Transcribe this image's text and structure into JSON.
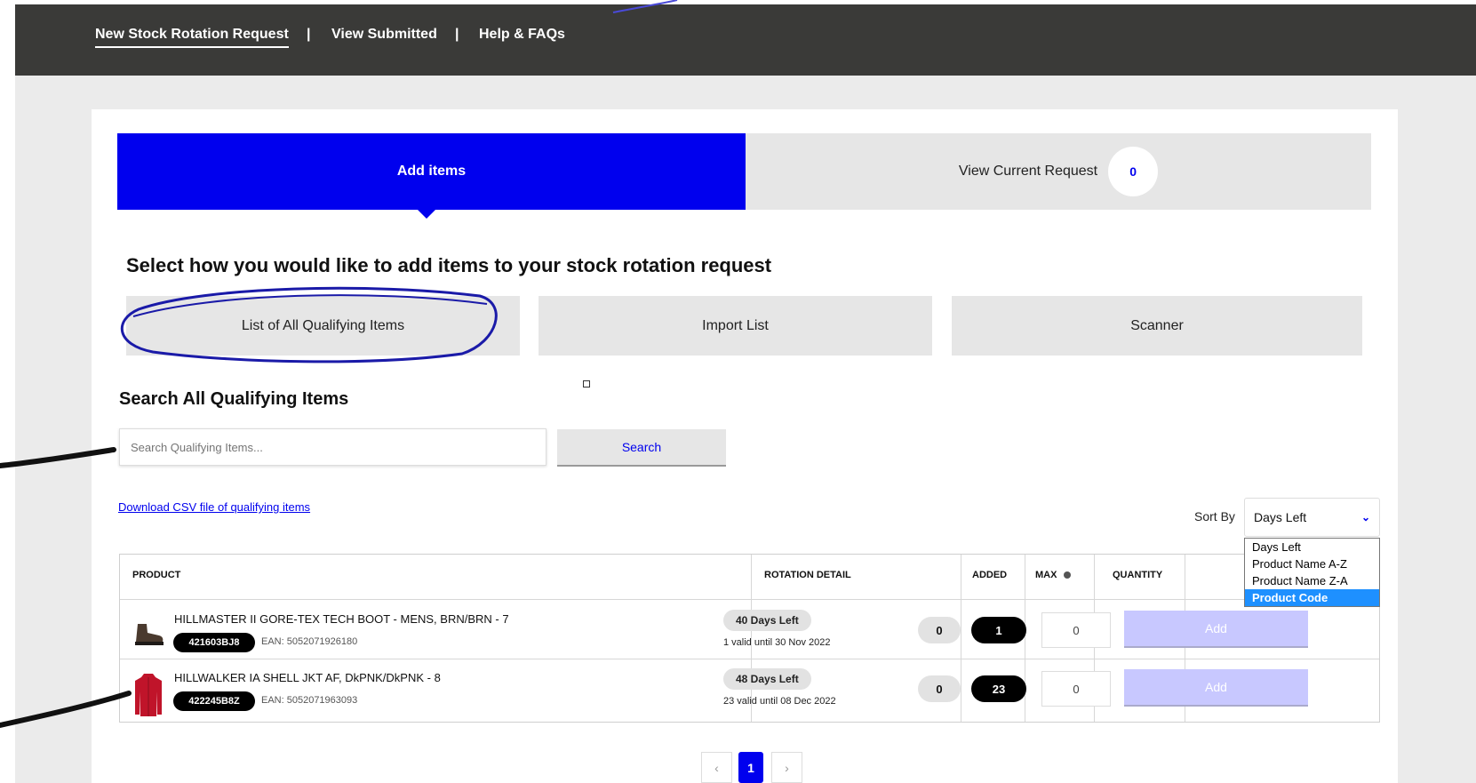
{
  "nav": {
    "items": [
      {
        "label": "New Stock Rotation Request"
      },
      {
        "label": "View Submitted"
      },
      {
        "label": "Help & FAQs"
      }
    ],
    "separator": "|"
  },
  "tabs": {
    "add_items": "Add items",
    "view_current": "View Current Request",
    "current_count": "0"
  },
  "heading": "Select how you would like to add items to your stock rotation request",
  "methods": {
    "list": "List of All Qualifying Items",
    "import": "Import List",
    "scanner": "Scanner"
  },
  "search": {
    "title": "Search All Qualifying Items",
    "placeholder": "Search Qualifying Items...",
    "button": "Search"
  },
  "csv_link": "Download CSV file of qualifying items",
  "sort": {
    "label": "Sort By",
    "selected": "Days Left",
    "options": [
      "Days Left",
      "Product Name A-Z",
      "Product Name Z-A",
      "Product Code"
    ],
    "highlighted": "Product Code"
  },
  "table": {
    "headers": {
      "product": "PRODUCT",
      "rotation": "ROTATION DETAIL",
      "added": "ADDED",
      "max": "MAX",
      "quantity": "QUANTITY"
    },
    "rows": [
      {
        "name": "HILLMASTER II GORE-TEX TECH BOOT - MENS, BRN/BRN - 7",
        "code": "421603BJ8",
        "ean": "EAN: 5052071926180",
        "days_left": "40 Days Left",
        "valid": "1 valid until 30 Nov 2022",
        "added": "0",
        "max": "1",
        "quantity": "0",
        "add_label": "Add",
        "icon": "boot-icon"
      },
      {
        "name": "HILLWALKER IA SHELL JKT AF, DkPNK/DkPNK - 8",
        "code": "422245B8Z",
        "ean": "EAN: 5052071963093",
        "days_left": "48 Days Left",
        "valid": "23 valid until 08 Dec 2022",
        "added": "0",
        "max": "23",
        "quantity": "0",
        "add_label": "Add",
        "icon": "jacket-icon"
      }
    ]
  },
  "pagination": {
    "prev": "‹",
    "current": "1",
    "next": "›"
  },
  "colors": {
    "accent": "#0000ee",
    "nav_bg": "#3a3a38",
    "page_bg": "#ebebeb",
    "add_disabled": "#c8c8ff",
    "annotation": "#1a1aa8"
  }
}
